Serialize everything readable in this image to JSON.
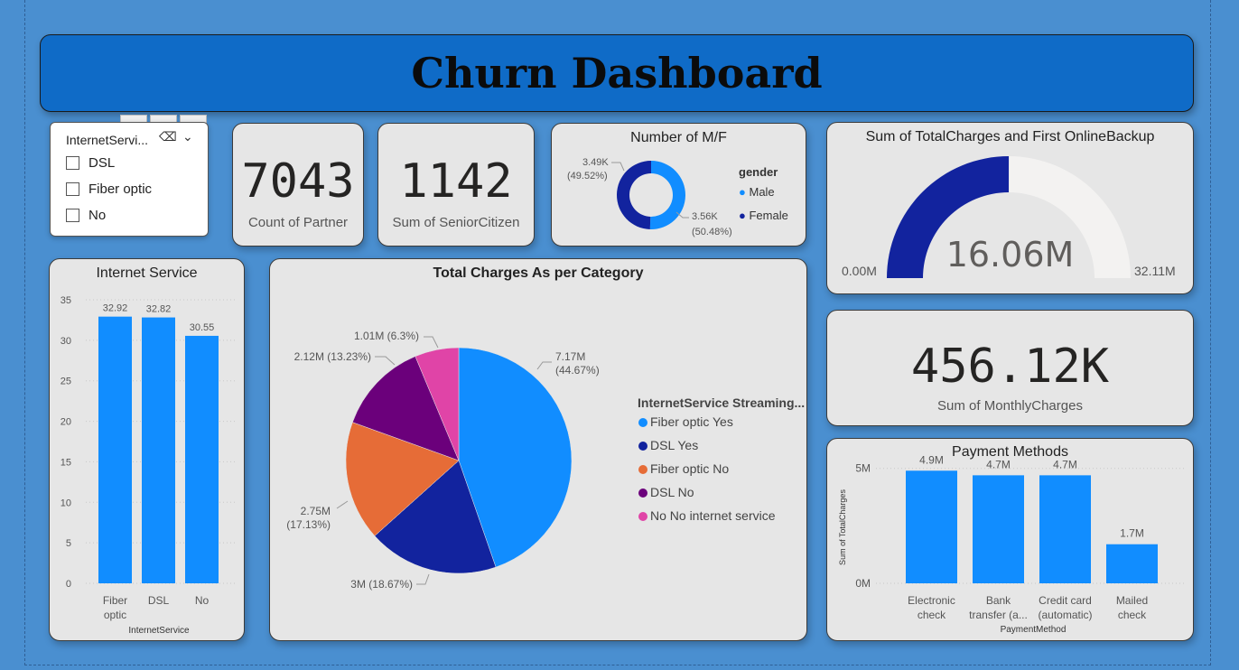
{
  "header": {
    "title": "Churn Dashboard"
  },
  "slicer": {
    "title": "InternetServi...",
    "options": [
      "DSL",
      "Fiber optic",
      "No"
    ]
  },
  "kpis": {
    "partner": {
      "value": "7043",
      "label": "Count of Partner"
    },
    "senior": {
      "value": "1142",
      "label": "Sum of SeniorCitizen"
    },
    "monthly": {
      "value": "456.12K",
      "label": "Sum of MonthlyCharges"
    }
  },
  "gender_card": {
    "title": "Number of M/F",
    "legend_title": "gender",
    "colors": {
      "Male": "#118dff",
      "Female": "#12239e"
    }
  },
  "gauge_card": {
    "title": "Sum of TotalCharges and First OnlineBackup",
    "value_label": "16.06M",
    "min_label": "0.00M",
    "max_label": "32.11M"
  },
  "colors": {
    "accent": "#118dff",
    "dark_blue": "#12239e",
    "header_bg": "#0f6bc7",
    "page_bg": "#4a8fd0"
  },
  "chart_data": [
    {
      "id": "gender",
      "type": "pie",
      "title": "Number of M/F",
      "legend_title": "gender",
      "slices": [
        {
          "name": "Female",
          "value": 3.49,
          "label": "3.49K",
          "pct": "(49.52%)",
          "color": "#12239e"
        },
        {
          "name": "Male",
          "value": 3.56,
          "label": "3.56K",
          "pct": "(50.48%)",
          "color": "#118dff"
        }
      ],
      "legend": [
        "Male",
        "Female"
      ]
    },
    {
      "id": "gauge",
      "type": "gauge",
      "title": "Sum of TotalCharges and First OnlineBackup",
      "value": 16.06,
      "min": 0,
      "max": 32.11,
      "unit": "M"
    },
    {
      "id": "internet",
      "type": "bar",
      "title": "Internet Service",
      "xlabel": "InternetService",
      "categories": [
        "Fiber optic",
        "DSL",
        "No"
      ],
      "values": [
        32.92,
        32.82,
        30.55
      ],
      "value_labels": [
        "32.92",
        "32.82",
        "30.55"
      ],
      "yticks": [
        0,
        5,
        10,
        15,
        20,
        25,
        30,
        35
      ],
      "ylim": [
        0,
        35
      ],
      "color": "#118dff"
    },
    {
      "id": "category",
      "type": "pie",
      "title": "Total Charges As per Category",
      "legend_title": "InternetService Streaming...",
      "slices": [
        {
          "name": "Fiber optic Yes",
          "value": 7.17,
          "label": "7.17M",
          "pct": "(44.67%)",
          "color": "#118dff"
        },
        {
          "name": "DSL Yes",
          "value": 3.0,
          "label": "3M",
          "pct": "(18.67%)",
          "color": "#12239e"
        },
        {
          "name": "Fiber optic No",
          "value": 2.75,
          "label": "2.75M",
          "pct": "(17.13%)",
          "color": "#e66c37"
        },
        {
          "name": "DSL No",
          "value": 2.12,
          "label": "2.12M",
          "pct": "(13.23%)",
          "color": "#6b007b"
        },
        {
          "name": "No No internet service",
          "value": 1.01,
          "label": "1.01M",
          "pct": "(6.3%)",
          "color": "#e044a7"
        }
      ]
    },
    {
      "id": "payment",
      "type": "bar",
      "title": "Payment Methods",
      "xlabel": "PaymentMethod",
      "ylabel": "Sum of TotalCharges",
      "categories": [
        [
          "Electronic",
          "check"
        ],
        [
          "Bank",
          "transfer (a..."
        ],
        [
          "Credit card",
          "(automatic)"
        ],
        [
          "Mailed",
          "check"
        ]
      ],
      "values": [
        4.9,
        4.7,
        4.7,
        1.7
      ],
      "value_labels": [
        "4.9M",
        "4.7M",
        "4.7M",
        "1.7M"
      ],
      "yticks": [
        "0M",
        "5M"
      ],
      "ylim": [
        0,
        5.5
      ],
      "color": "#118dff"
    }
  ]
}
